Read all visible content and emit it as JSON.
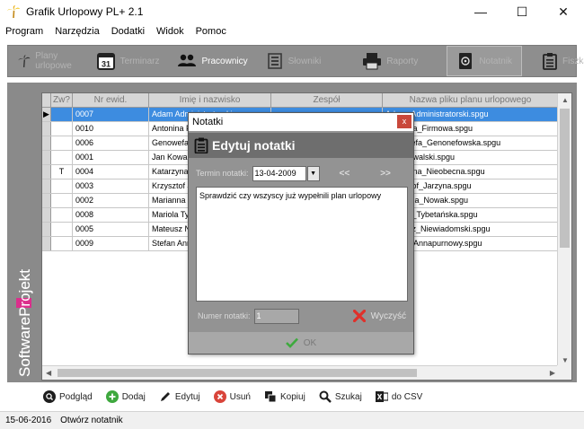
{
  "window": {
    "title": "Grafik Urlopowy PL+ 2.1",
    "minimize": "—",
    "maximize": "☐",
    "close": "✕"
  },
  "menu": [
    "Program",
    "Narzędzia",
    "Dodatki",
    "Widok",
    "Pomoc"
  ],
  "toolbar": {
    "plany": "Plany urlopowe",
    "terminarz": "Terminarz",
    "terminarz_icon_text": "31",
    "pracownicy": "Pracownicy",
    "slowniki": "Słowniki",
    "raporty": "Raporty",
    "notatnik": "Notatnik",
    "fiszka": "Fiszka"
  },
  "brand": {
    "text": "SoftwareProjekt"
  },
  "grid": {
    "columns": [
      "Zw?",
      "Nr ewid.",
      "Imię i nazwisko",
      "Zespół",
      "Nazwa pliku planu urlopowego"
    ],
    "rows": [
      {
        "zw": "",
        "nr": "0007",
        "imie": "Adam Administratorski",
        "zesp": "",
        "plik": "Adam_Administratorski.spgu"
      },
      {
        "zw": "",
        "nr": "0010",
        "imie": "Antonina Firmowa",
        "zesp": "",
        "plik": "Antonina_Firmowa.spgu"
      },
      {
        "zw": "",
        "nr": "0006",
        "imie": "Genowefa Genonefowska",
        "zesp": "",
        "plik": "Genowefa_Genonefowska.spgu"
      },
      {
        "zw": "",
        "nr": "0001",
        "imie": "Jan Kowalski",
        "zesp": "",
        "plik": "Jan_Kowalski.spgu"
      },
      {
        "zw": "T",
        "nr": "0004",
        "imie": "Katarzyna Nieobecna",
        "zesp": "",
        "plik": "Katarzyna_Nieobecna.spgu"
      },
      {
        "zw": "",
        "nr": "0003",
        "imie": "Krzysztof Jarzyna",
        "zesp": "",
        "plik": "Krzysztof_Jarzyna.spgu"
      },
      {
        "zw": "",
        "nr": "0002",
        "imie": "Marianna Nowak",
        "zesp": "",
        "plik": "Marianna_Nowak.spgu"
      },
      {
        "zw": "",
        "nr": "0008",
        "imie": "Mariola Tybetańska",
        "zesp": "",
        "plik": "Mariola_Tybetańska.spgu"
      },
      {
        "zw": "",
        "nr": "0005",
        "imie": "Mateusz Niewiadomski",
        "zesp": "",
        "plik": "Mateusz_Niewiadomski.spgu"
      },
      {
        "zw": "",
        "nr": "0009",
        "imie": "Stefan Annapurnowy",
        "zesp": "",
        "plik": "Stefan_Annapurnowy.spgu"
      }
    ]
  },
  "actions": {
    "podglad": "Podgląd",
    "dodaj": "Dodaj",
    "edytuj": "Edytuj",
    "usun": "Usuń",
    "kopiuj": "Kopiuj",
    "szukaj": "Szukaj",
    "csv": "do CSV"
  },
  "status": {
    "date": "15-06-2016",
    "message": "Otwórz notatnik"
  },
  "dialog": {
    "title": "Notatki",
    "close": "x",
    "heading": "Edytuj notatki",
    "date_label": "Termin notatki:",
    "date_value": "13-04-2009",
    "prev": "<<",
    "next": ">>",
    "note_text": "Sprawdzić czy wszyscy już wypełnili plan urlopowy",
    "number_label": "Numer notatki:",
    "number_value": "1",
    "clear": "Wyczyść",
    "ok": "OK"
  },
  "colors": {
    "selection": "#3d8ce0",
    "panel": "#8a8a8a",
    "toolbar": "#8e8e8e",
    "accent_brand": "#e91e8c",
    "close_red": "#c9483b"
  }
}
